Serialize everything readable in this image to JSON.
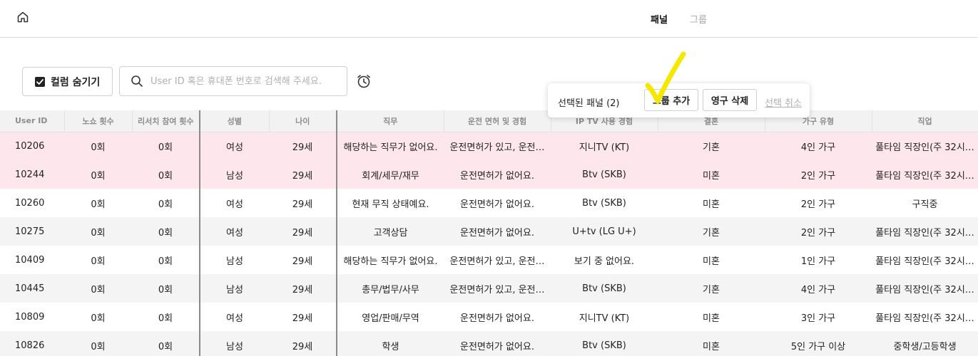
{
  "nav": {
    "home_icon": "home-icon",
    "tabs": [
      {
        "label": "패널",
        "active": true
      },
      {
        "label": "그룹",
        "active": false
      }
    ]
  },
  "toolbar": {
    "hide_columns_label": "컬럼 숨기기",
    "hide_columns_checked": true,
    "search_placeholder": "User ID 혹은 휴대폰 번호로 검색해 주세요.",
    "search_value": "",
    "clock_icon": "clock-icon"
  },
  "selection_popup": {
    "label": "선택된 패널 (2)",
    "add_group_label": "그룹 추가",
    "delete_label": "영구 삭제",
    "cancel_label": "선택 취소"
  },
  "annotation": {
    "color": "#f5e800",
    "icon": "checkmark-annotation"
  },
  "colors": {
    "selected_row": "#fde6ec",
    "header_bg": "#f2f2f2",
    "alt_row": "#f4f4f4"
  },
  "table": {
    "columns": [
      "User ID",
      "노쇼 횟수",
      "리서치 참여 횟수",
      "성별",
      "나이",
      "직무",
      "운전 면허 및 경험",
      "IP TV 사용 경험",
      "결혼",
      "가구 유형",
      "직업"
    ],
    "rows": [
      {
        "selected": true,
        "cells": [
          "10206",
          "0회",
          "0회",
          "여성",
          "29세",
          "해당하는 직무가 없어요.",
          "운전면허가 있고, 운전…",
          "지니TV (KT)",
          "기혼",
          "4인 가구",
          "풀타임 직장인(주 32시…"
        ]
      },
      {
        "selected": true,
        "cells": [
          "10244",
          "0회",
          "0회",
          "남성",
          "29세",
          "회계/세무/재무",
          "운전면허가 없어요.",
          "Btv (SKB)",
          "미혼",
          "2인 가구",
          "풀타임 직장인(주 32시…"
        ]
      },
      {
        "selected": false,
        "cells": [
          "10260",
          "0회",
          "0회",
          "여성",
          "29세",
          "현재 무직 상태예요.",
          "운전면허가 없어요.",
          "Btv (SKB)",
          "미혼",
          "2인 가구",
          "구직중"
        ]
      },
      {
        "selected": false,
        "cells": [
          "10275",
          "0회",
          "0회",
          "여성",
          "29세",
          "고객상담",
          "운전면허가 없어요.",
          "U+tv (LG U+)",
          "기혼",
          "2인 가구",
          "풀타임 직장인(주 32시…"
        ]
      },
      {
        "selected": false,
        "cells": [
          "10409",
          "0회",
          "0회",
          "남성",
          "29세",
          "해당하는 직무가 없어요.",
          "운전면허가 있고, 운전…",
          "보기 중 없어요.",
          "미혼",
          "1인 가구",
          "풀타임 직장인(주 32시…"
        ]
      },
      {
        "selected": false,
        "cells": [
          "10445",
          "0회",
          "0회",
          "남성",
          "29세",
          "총무/법무/사무",
          "운전면허가 있고, 운전…",
          "Btv (SKB)",
          "기혼",
          "4인 가구",
          "풀타임 직장인(주 32시…"
        ]
      },
      {
        "selected": false,
        "cells": [
          "10809",
          "0회",
          "0회",
          "여성",
          "29세",
          "영업/판매/무역",
          "운전면허가 없어요.",
          "지니TV (KT)",
          "미혼",
          "3인 가구",
          "풀타임 직장인(주 32시…"
        ]
      },
      {
        "selected": false,
        "cells": [
          "10826",
          "0회",
          "0회",
          "남성",
          "29세",
          "학생",
          "운전면허가 없어요.",
          "Btv (SKB)",
          "미혼",
          "5인 가구 이상",
          "중학생/고등학생"
        ]
      }
    ]
  }
}
